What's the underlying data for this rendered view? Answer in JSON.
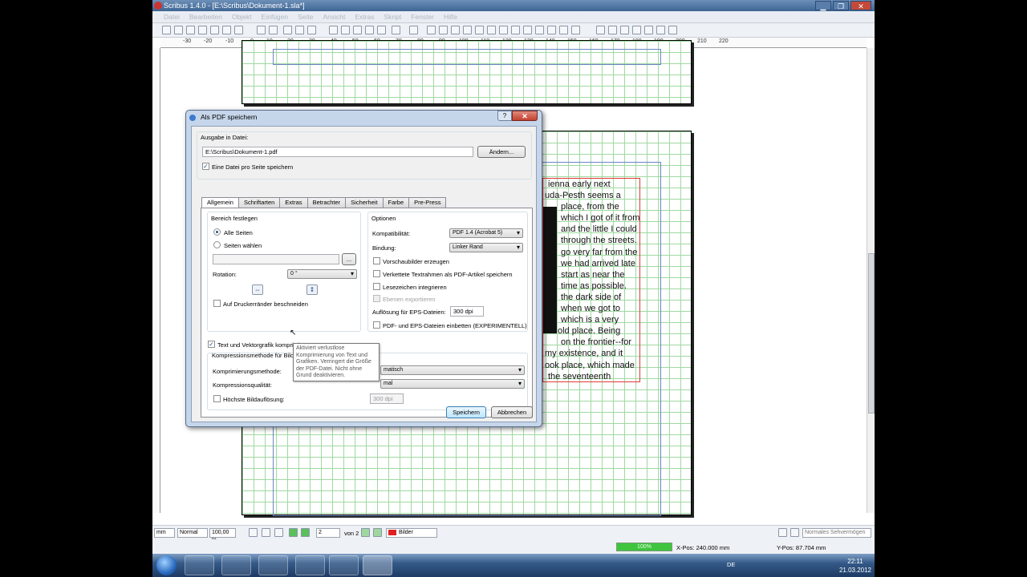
{
  "window": {
    "title": "Scribus 1.4.0 - [E:\\Scribus\\Dokument-1.sla*]",
    "min": "▁",
    "max": "❐",
    "close": "✕"
  },
  "menu": [
    "Datei",
    "Bearbeiten",
    "Objekt",
    "Einfügen",
    "Seite",
    "Ansicht",
    "Extras",
    "Skript",
    "Fenster",
    "Hilfe"
  ],
  "ruler_ticks": [
    "-30",
    "-20",
    "-10",
    "0",
    "10",
    "20",
    "30",
    "40",
    "50",
    "60",
    "70",
    "80",
    "90",
    "100",
    "110",
    "120",
    "130",
    "140",
    "150",
    "160",
    "170",
    "180",
    "190",
    "200",
    "210",
    "220"
  ],
  "document_text": [
    "ienna early next",
    "uda-Pesth seems a",
    "place, from the",
    "which I got of it from",
    "and the little I could",
    "through the streets. I",
    "go very far from the",
    "we had arrived late",
    "start as near the",
    "time as possible.",
    "the dark side of",
    "when we got to",
    "which is a very",
    "old place. Being",
    "on the frontier--for",
    "my existence, and it",
    "ook place, which made",
    "the seventeenth"
  ],
  "dialog": {
    "title": "Als PDF speichern",
    "help": "?",
    "close": "✕",
    "output_label": "Ausgabe in Datei:",
    "output_path": "E:\\Scribus\\Dokument-1.pdf",
    "change_button": "Ändern...",
    "one_file_per_page": "Eine Datei pro Seite speichern",
    "tabs": [
      "Allgemein",
      "Schriftarten",
      "Extras",
      "Betrachter",
      "Sicherheit",
      "Farbe",
      "Pre-Press"
    ],
    "range": {
      "group_label": "Bereich festlegen",
      "all_pages": "Alle Seiten",
      "choose_pages": "Seiten wählen",
      "ellipsis": "...",
      "rotation_label": "Rotation:",
      "rotation_value": "0 °",
      "crop_marks": "Auf Druckerränder beschneiden"
    },
    "options": {
      "group_label": "Optionen",
      "compat_label": "Kompatibilität:",
      "compat_value": "PDF 1.4 (Acrobat 5)",
      "binding_label": "Bindung:",
      "binding_value": "Linker Rand",
      "thumbnails": "Vorschaubilder erzeugen",
      "linked_frames": "Verkettete Textrahmen als PDF-Artikel speichern",
      "bookmarks": "Lesezeichen integrieren",
      "layers": "Ebenen exportieren",
      "eps_res_label": "Auflösung für EPS-Dateien:",
      "eps_res_value": "300 dpi",
      "embed_eps": "PDF- und EPS-Dateien einbetten (EXPERIMENTELL)"
    },
    "compress_text": "Text und Vektorgrafik komprimieren",
    "compression": {
      "group_label": "Kompressionsmethode für Bilder",
      "method_label": "Komprimierungsmethode:",
      "method_value": "matisch",
      "quality_label": "Kompressionsqualität:",
      "quality_value": "mal",
      "max_res_label": "Höchste Bildauflösung:",
      "max_res_value": "300 dpi"
    },
    "tooltip": "Aktiviert verlustlose Komprimierung von Text und Grafiken. Verringert die Größe der PDF-Datei. Nicht ohne Grund deaktivieren.",
    "save_button": "Speichern",
    "cancel_button": "Abbrechen"
  },
  "statusbar": {
    "unit": "mm",
    "mode": "Normal",
    "zoom": "100,00 %",
    "page": "2",
    "of_pages": "von 2",
    "layer": "Bilder",
    "view_mode": "Normales Sehvermögen",
    "progress": "100%",
    "progress_fraction": 1.0,
    "xpos": "X-Pos:  240.000 mm",
    "ypos": "Y-Pos:  87.704 mm"
  },
  "taskbar": {
    "lang": "DE",
    "time": "22:11",
    "date": "21.03.2012"
  },
  "colors": {
    "accent": "#3c7fb1",
    "layer_color": "#e02020",
    "grid": "#9fd9a0",
    "frame": "#e03a3a"
  }
}
